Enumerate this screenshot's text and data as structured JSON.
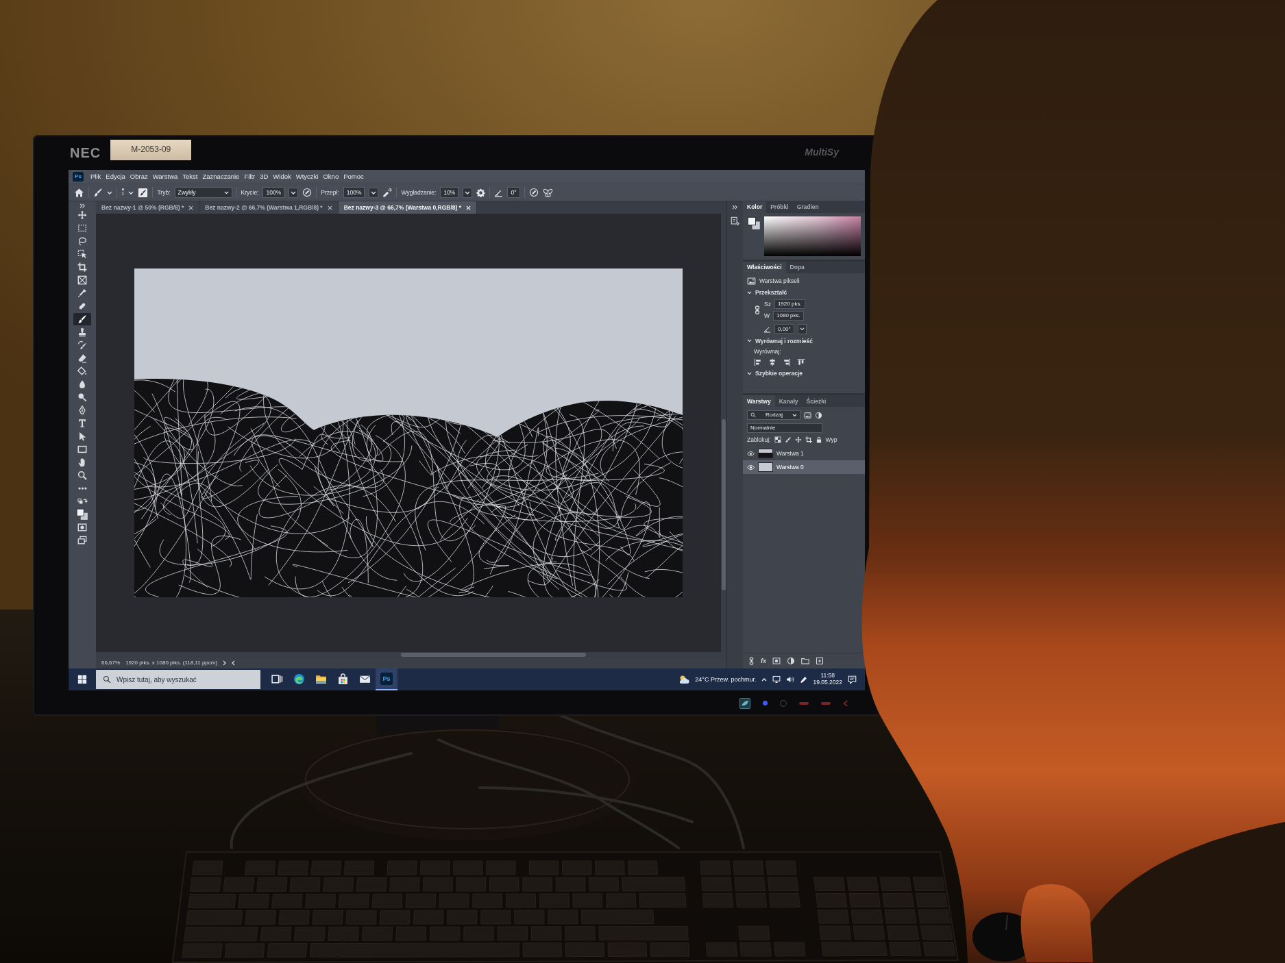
{
  "monitor": {
    "brand": "NEC",
    "asset_tag": "M-2053-09",
    "model": "MultiSy"
  },
  "app_logo": "Ps",
  "menu_bar": [
    "Plik",
    "Edycja",
    "Obraz",
    "Warstwa",
    "Tekst",
    "Zaznaczanie",
    "Filtr",
    "3D",
    "Widok",
    "Wtyczki",
    "Okno",
    "Pomoc"
  ],
  "options_bar": {
    "brush_size": "1",
    "mode_label": "Tryb:",
    "mode": "Zwykły",
    "opacity_label": "Krycie:",
    "opacity": "100%",
    "flow_label": "Przepł:",
    "flow": "100%",
    "smoothing_label": "Wygładzanie:",
    "smoothing": "10%",
    "angle": "0°"
  },
  "tabs": [
    {
      "label": "Bez nazwy-1 @ 50% (RGB/8) *",
      "selected": false
    },
    {
      "label": "Bez nazwy-2 @ 66,7% (Warstwa 1,RGB/8) *",
      "selected": false
    },
    {
      "label": "Bez nazwy-3 @ 66,7% (Warstwa 0,RGB/8) *",
      "selected": true
    }
  ],
  "tools": [
    {
      "kind": "move",
      "selected": false
    },
    {
      "kind": "marquee",
      "selected": false
    },
    {
      "kind": "lasso",
      "selected": false
    },
    {
      "kind": "object_select",
      "selected": false
    },
    {
      "kind": "crop",
      "selected": false
    },
    {
      "kind": "frame",
      "selected": false
    },
    {
      "kind": "eyedropper",
      "selected": false
    },
    {
      "kind": "healing",
      "selected": false
    },
    {
      "kind": "brush",
      "selected": true
    },
    {
      "kind": "stamp",
      "selected": false
    },
    {
      "kind": "history_brush",
      "selected": false
    },
    {
      "kind": "eraser",
      "selected": false
    },
    {
      "kind": "bucket",
      "selected": false
    },
    {
      "kind": "blur",
      "selected": false
    },
    {
      "kind": "dodge",
      "selected": false
    },
    {
      "kind": "pen",
      "selected": false
    },
    {
      "kind": "type",
      "selected": false
    },
    {
      "kind": "path_select",
      "selected": false
    },
    {
      "kind": "rectangle",
      "selected": false
    },
    {
      "kind": "hand",
      "selected": false
    },
    {
      "kind": "zoom",
      "selected": false
    },
    {
      "kind": "more",
      "selected": false
    },
    {
      "kind": "swap_colors",
      "selected": false
    },
    {
      "kind": "colors",
      "selected": false
    },
    {
      "kind": "quick_mask",
      "selected": false
    },
    {
      "kind": "screen_mode",
      "selected": false
    }
  ],
  "color_panel": {
    "tabs": [
      {
        "label": "Kolor",
        "selected": true
      },
      {
        "label": "Próbki",
        "selected": false
      },
      {
        "label": "Gradien",
        "selected": false
      }
    ]
  },
  "properties_panel": {
    "tabs": [
      {
        "label": "Właściwości",
        "selected": true
      },
      {
        "label": "Dopa",
        "selected": false
      }
    ],
    "layer_type": "Warstwa pikseli",
    "sections": [
      {
        "kind": "transform",
        "title": "Przekształć",
        "expanded": true,
        "width_label": "Sz",
        "width": "1920 pks.",
        "height_label": "W",
        "height": "1080 pks.",
        "angle": "0,00°"
      },
      {
        "kind": "align",
        "title": "Wyrównaj i rozmieść",
        "expanded": true,
        "align_label": "Wyrównaj:"
      },
      {
        "kind": "quick_actions",
        "title": "Szybkie operacje",
        "expanded": true
      }
    ]
  },
  "layers_panel": {
    "tabs": [
      {
        "label": "Warstwy",
        "selected": true
      },
      {
        "label": "Kanały",
        "selected": false
      },
      {
        "label": "Ścieżki",
        "selected": false
      }
    ],
    "filter": "Rodzaj",
    "blend_mode": "Normalnie",
    "lock_label": "Zablokuj:",
    "fill_label": "Wyp",
    "layers": [
      {
        "name": "Warstwa 1",
        "selected": false
      },
      {
        "name": "Warstwa 0",
        "selected": true
      }
    ],
    "effects_label": "fx"
  },
  "status_bar": {
    "zoom": "66,67%",
    "info": "1920 piks. x 1080 piks. (118,11 ppcm)"
  },
  "taskbar": {
    "search": {
      "placeholder": "Wpisz tutaj, aby wyszukać"
    },
    "apps": [
      {
        "kind": "task_view",
        "selected": false
      },
      {
        "kind": "edge",
        "selected": false
      },
      {
        "kind": "explorer",
        "selected": false
      },
      {
        "kind": "store",
        "selected": false
      },
      {
        "kind": "mail",
        "selected": false
      },
      {
        "kind": "photoshop",
        "label": "Ps",
        "selected": true
      }
    ],
    "weather": "24°C Przew. pochmur.",
    "time": "11:58",
    "date": "19.05.2022"
  }
}
